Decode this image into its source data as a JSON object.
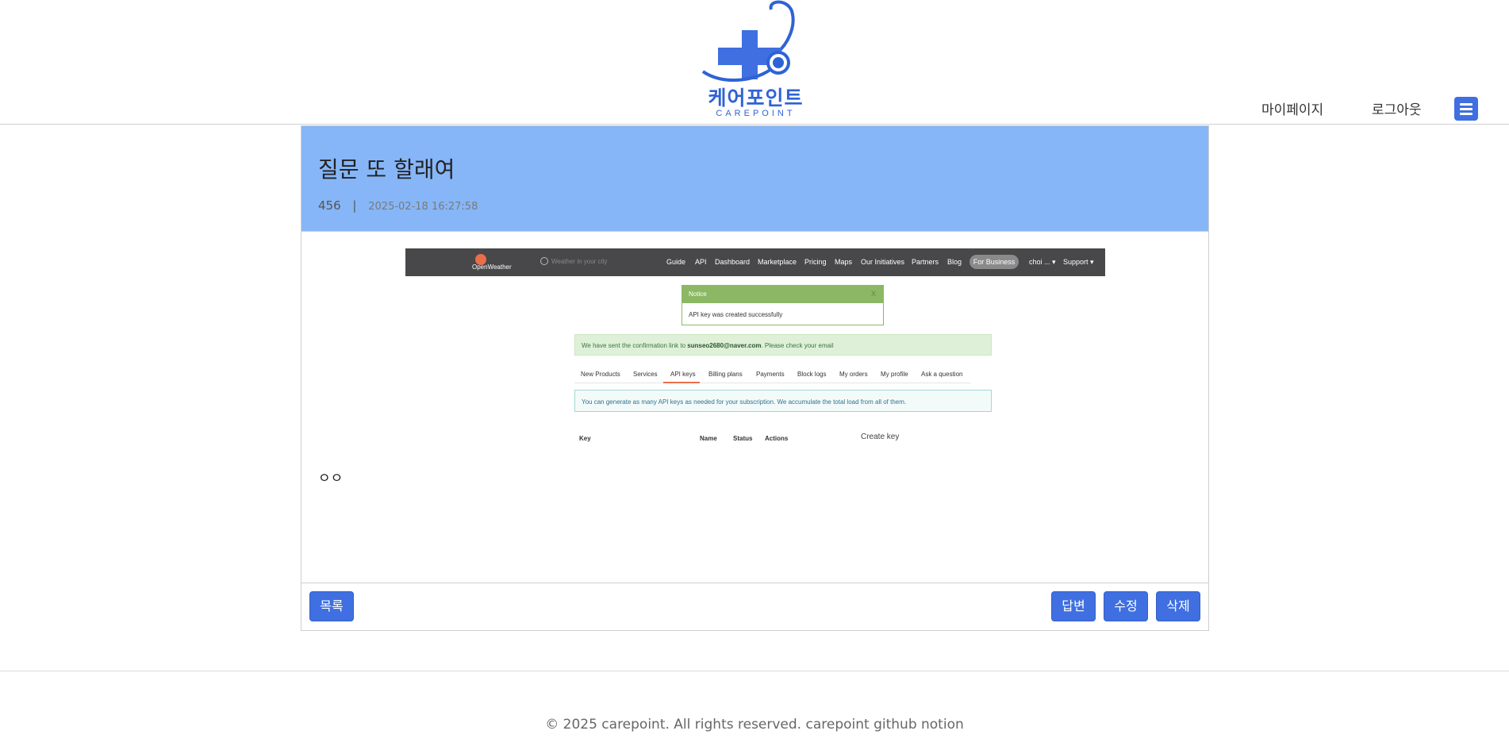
{
  "header": {
    "logo_text": "케어포인트",
    "logo_sub": "CAREPOINT",
    "mypage": "마이페이지",
    "logout": "로그아웃",
    "accent": "#3f6fe0"
  },
  "post": {
    "title": "질문 또 할래여",
    "author": "456",
    "separator": "|",
    "date": "2025-02-18 16:27:58",
    "body": "ㅇㅇ",
    "header_color": "#86b6f7"
  },
  "screenshot": {
    "logo": "OpenWeather",
    "search_placeholder": "Weather in your city",
    "nav": [
      "Guide",
      "API",
      "Dashboard",
      "Marketplace",
      "Pricing",
      "Maps",
      "Our Initiatives",
      "Partners",
      "Blog"
    ],
    "for_business": "For Business",
    "user": "choi ... ▾",
    "support": "Support ▾",
    "notice_title": "Notice",
    "notice_close": "X",
    "notice_body": "API key was created successfully",
    "confirm_prefix": "We have sent the confirmation link to",
    "confirm_email": "sunseo2680@naver.com",
    "confirm_suffix": ". Please check your email",
    "tabs": [
      "New Products",
      "Services",
      "API keys",
      "Billing plans",
      "Payments",
      "Block logs",
      "My orders",
      "My profile",
      "Ask a question"
    ],
    "info": "You can generate as many API keys as needed for your subscription. We accumulate the total load from all of them.",
    "columns": [
      "Key",
      "Name",
      "Status",
      "Actions"
    ],
    "create_key": "Create key"
  },
  "actions": {
    "list": "목록",
    "reply": "답변",
    "edit": "수정",
    "delete": "삭제"
  },
  "footer": {
    "text": "© 2025 carepoint. All rights reserved. carepoint github notion"
  }
}
